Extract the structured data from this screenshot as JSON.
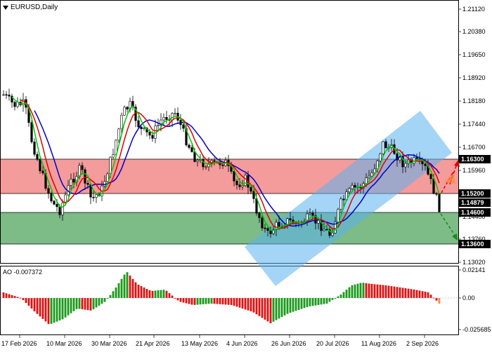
{
  "header": {
    "symbol": "EURUSD,Daily"
  },
  "indicator": {
    "label": "AO -0.007372"
  },
  "colors": {
    "resistance_zone": "#f28a8a",
    "support_zone": "#6fb47a",
    "channel": "#5bb3ee",
    "ma_fast": "#00c800",
    "ma_mid": "#e00000",
    "ma_slow": "#0000c8",
    "ao_up": "#1a9a1a",
    "ao_down": "#e01010",
    "candle": "#000000"
  },
  "price_axis": {
    "ticks": [
      "1.21120",
      "1.20380",
      "1.19650",
      "1.18920",
      "1.18180",
      "1.17440",
      "1.16700",
      "1.15960",
      "1.13760",
      "1.13020",
      "1.14400"
    ],
    "level_tags": [
      "1.16300",
      "1.15200",
      "1.14879",
      "1.14600",
      "1.13600"
    ]
  },
  "ao_axis": {
    "ticks": [
      "0.02141",
      "0.00",
      "-0.025685"
    ]
  },
  "time_axis": {
    "labels": [
      "17 Feb 2026",
      "10 Mar 2026",
      "30 Mar 2026",
      "21 Apr 2026",
      "13 May 2026",
      "4 Jun 2026",
      "26 Jun 2026",
      "20 Jul 2026",
      "11 Aug 2026",
      "2 Sep 2026"
    ]
  },
  "chart_data": {
    "type": "candlestick",
    "title": "EURUSD,Daily",
    "ylim": [
      1.128,
      1.214
    ],
    "zones": [
      {
        "name": "resistance",
        "from": 1.152,
        "to": 1.163
      },
      {
        "name": "support",
        "from": 1.136,
        "to": 1.146
      }
    ],
    "levels": [
      1.163,
      1.152,
      1.146,
      1.136
    ],
    "last_price": 1.14879,
    "ao_value": -0.007372,
    "ao_range": [
      -0.025685,
      0.02141
    ]
  }
}
